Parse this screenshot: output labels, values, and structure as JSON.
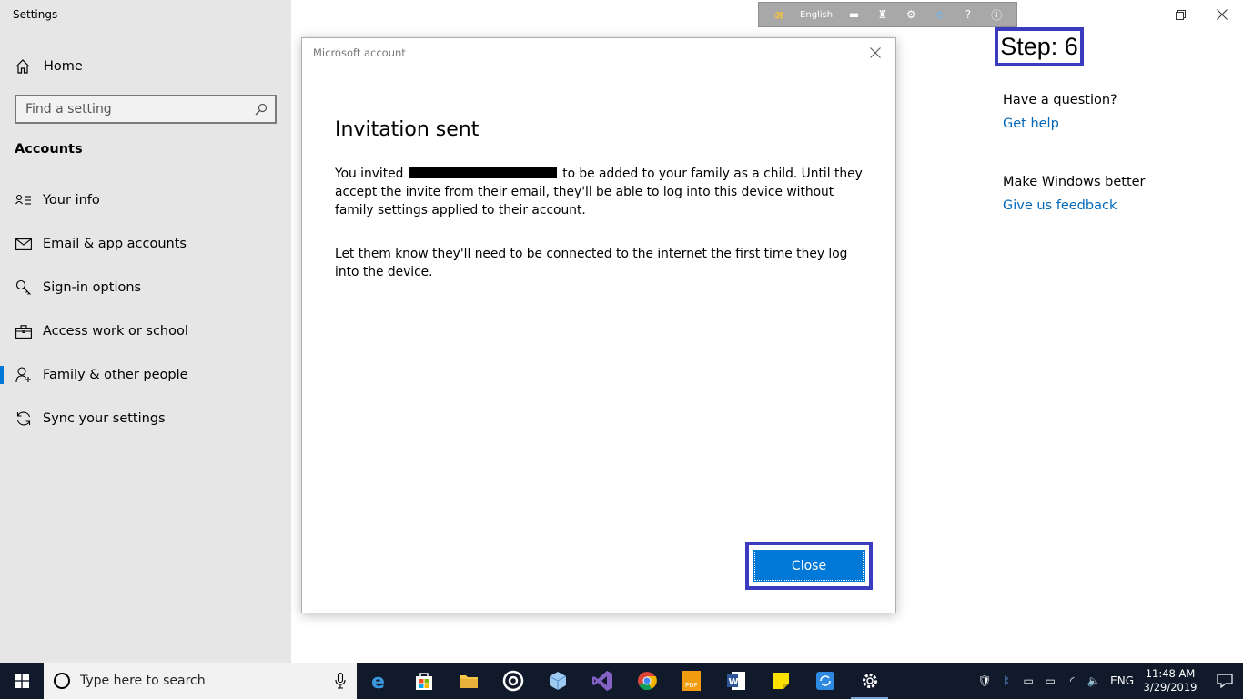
{
  "window": {
    "app_title": "Settings"
  },
  "sidebar": {
    "home_label": "Home",
    "search_placeholder": "Find a setting",
    "section_title": "Accounts",
    "items": [
      {
        "label": "Your info",
        "icon": "contact-card-icon"
      },
      {
        "label": "Email & app accounts",
        "icon": "mail-icon"
      },
      {
        "label": "Sign-in options",
        "icon": "key-icon"
      },
      {
        "label": "Access work or school",
        "icon": "briefcase-icon"
      },
      {
        "label": "Family & other people",
        "icon": "add-person-icon",
        "active": true
      },
      {
        "label": "Sync your settings",
        "icon": "sync-icon"
      }
    ]
  },
  "ime_bar": {
    "language": "English"
  },
  "step_label": "Step: 6",
  "right_panel": {
    "question_heading": "Have a question?",
    "get_help": "Get help",
    "feedback_heading": "Make Windows better",
    "feedback_link": "Give us feedback"
  },
  "dialog": {
    "title": "Microsoft account",
    "heading": "Invitation sent",
    "para1_before": "You invited",
    "para1_after": "to be added to your family as a child. Until they accept the invite from their email, they'll be able to log into this device without family settings applied to their account.",
    "para2": "Let them know they'll need to be connected to the internet the first time they log into the device.",
    "close_label": "Close"
  },
  "taskbar": {
    "search_placeholder": "Type here to search",
    "language": "ENG",
    "time": "11:48 AM",
    "date": "3/29/2019"
  },
  "colors": {
    "accent": "#0078d7",
    "link": "#0067b8",
    "annotation_border": "#3b3bbf",
    "sidebar_bg": "#e6e6e6",
    "taskbar_bg": "#101a2b"
  }
}
